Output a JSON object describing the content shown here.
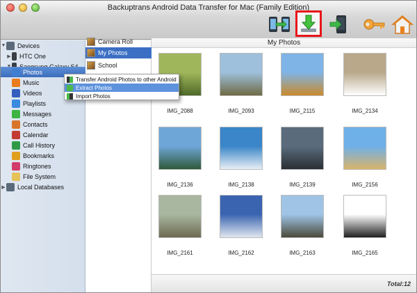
{
  "window": {
    "title": "Backuptrans Android Data Transfer for Mac (Family Edition)"
  },
  "toolbar": {
    "transfer_icon": "phones-transfer-icon",
    "export_icon": "download-arrow-icon",
    "phone_icon": "phone-arrow-icon",
    "key_icon": "key-icon",
    "home_icon": "home-icon",
    "highlight_color": "#e8141a"
  },
  "sidebar": {
    "devices_label": "Devices",
    "htc_label": "HTC One",
    "samsung_label": "Sangsung Galaxy S4",
    "items": [
      {
        "label": "Photos",
        "color": "#3f7fd1"
      },
      {
        "label": "Music",
        "color": "#e87c1e"
      },
      {
        "label": "Videos",
        "color": "#355fbd"
      },
      {
        "label": "Playlists",
        "color": "#3a8be0"
      },
      {
        "label": "Messages",
        "color": "#3db443"
      },
      {
        "label": "Contacts",
        "color": "#d9752b"
      },
      {
        "label": "Calendar",
        "color": "#c23a32"
      },
      {
        "label": "Call History",
        "color": "#2f9a46"
      },
      {
        "label": "Bookmarks",
        "color": "#e0a01e"
      },
      {
        "label": "Ringtones",
        "color": "#d23c6a"
      },
      {
        "label": "File System",
        "color": "#e6c35a"
      }
    ],
    "local_label": "Local Databases"
  },
  "albums": [
    {
      "label": "Camera Roll"
    },
    {
      "label": "My Photos"
    },
    {
      "label": "School"
    }
  ],
  "context_menu": [
    {
      "label": "Transfer Android Photos to other Android"
    },
    {
      "label": "Extract Photos"
    },
    {
      "label": "Import Photos"
    }
  ],
  "main": {
    "header": "My Photos",
    "photos": [
      {
        "name": "IMG_2088",
        "c1": "#9fb65a",
        "c2": "#4f6a2a"
      },
      {
        "name": "IMG_2093",
        "c1": "#9ec0dc",
        "c2": "#6f6a45"
      },
      {
        "name": "IMG_2115",
        "c1": "#7fb4e6",
        "c2": "#c98a2c"
      },
      {
        "name": "IMG_2134",
        "c1": "#b9a98a",
        "c2": "#ffffff"
      },
      {
        "name": "IMG_2136",
        "c1": "#6fa6d8",
        "c2": "#2f5a3a"
      },
      {
        "name": "IMG_2138",
        "c1": "#3a86c9",
        "c2": "#e8eef5"
      },
      {
        "name": "IMG_2139",
        "c1": "#5a6c7c",
        "c2": "#2a2f35"
      },
      {
        "name": "IMG_2156",
        "c1": "#6fb0e8",
        "c2": "#d8b46a"
      },
      {
        "name": "IMG_2161",
        "c1": "#a9b7a0",
        "c2": "#6e6a50"
      },
      {
        "name": "IMG_2162",
        "c1": "#3a64b0",
        "c2": "#dfe6ef"
      },
      {
        "name": "IMG_2163",
        "c1": "#9fc4e6",
        "c2": "#4a4a3a"
      },
      {
        "name": "IMG_2165",
        "c1": "#ffffff",
        "c2": "#202020"
      }
    ],
    "total": "Total:12"
  }
}
